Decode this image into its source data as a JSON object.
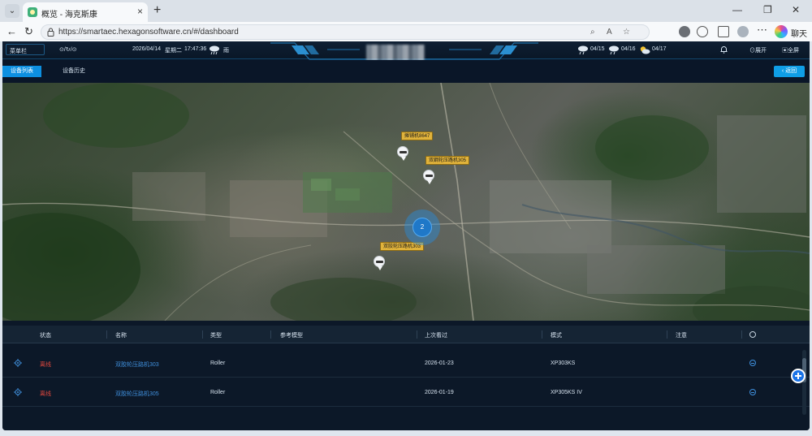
{
  "browser": {
    "tab_title": "概览 - 海克斯康",
    "tab_close": "×",
    "new_tab": "+",
    "tab_list": "⌄",
    "url": "https://smartaec.hexagonsoftware.cn/#/dashboard",
    "chat_label": "聊天",
    "window_controls": [
      "—",
      "❐",
      "✕"
    ],
    "nav": {
      "back": "←",
      "refresh": "↻"
    }
  },
  "topbar": {
    "menu_label": "菜单栏",
    "search_label": "⊙/↻/⊙",
    "date": "2026/04/14",
    "weekday": "星期二",
    "time": "17:47:36",
    "current_weather": "雨",
    "forecast": [
      {
        "date": "04/15",
        "icon": "rain-icon"
      },
      {
        "date": "04/16",
        "icon": "rain-icon"
      },
      {
        "date": "04/17",
        "icon": "partly-cloudy-icon"
      }
    ],
    "bell_label": "",
    "expand_label": "展开",
    "fullscreen_label": "全屏"
  },
  "subnav": {
    "tabs": [
      {
        "label": "设备列表",
        "active": true
      },
      {
        "label": "设备历史",
        "active": false
      }
    ],
    "back_label": "返回"
  },
  "map": {
    "markers": [
      {
        "label": "摊铺机8647"
      },
      {
        "label": "双鋼轮压路机305"
      },
      {
        "label": "双胶轮压路机303"
      }
    ],
    "cluster_count": "2"
  },
  "table": {
    "columns": [
      "状态",
      "名称",
      "类型",
      "参考模型",
      "上次看过",
      "模式",
      "注意"
    ],
    "rows": [
      {
        "status": "离线",
        "name": "双胶轮压路机303",
        "type": "Roller",
        "reference_model": "",
        "last_seen": "2026-01-23",
        "mode": "XP303KS",
        "note": ""
      },
      {
        "status": "离线",
        "name": "双胶轮压路机305",
        "type": "Roller",
        "reference_model": "",
        "last_seen": "2026-01-19",
        "mode": "XP305KS IV",
        "note": ""
      }
    ]
  },
  "colors": {
    "accent": "#0d8fe0",
    "offline": "#e0483e",
    "link": "#3f8fdc",
    "marker_label_bg": "#e1b33b",
    "app_bg": "#0a1526"
  }
}
